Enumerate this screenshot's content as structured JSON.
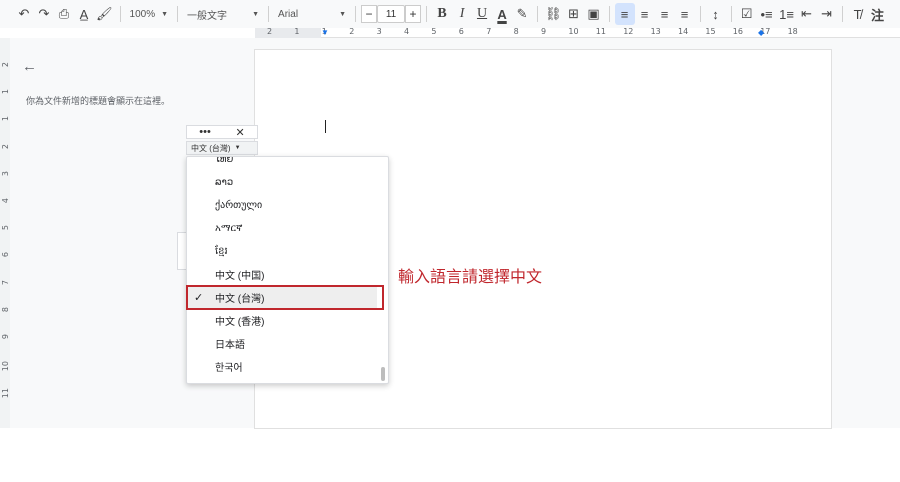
{
  "toolbar": {
    "zoom": "100%",
    "style": "一般文字",
    "font": "Arial",
    "font_size": "11",
    "minus": "−",
    "plus": "+",
    "bold": "B",
    "italic": "I",
    "underline": "U",
    "text_color": "A",
    "highlight": "✎",
    "link": "⛓",
    "comment": "⊞",
    "image": "▣",
    "align_left": "≡",
    "align_center": "≡",
    "align_right": "≡",
    "justify": "≡",
    "line_spacing": "↕",
    "checklist": "☑",
    "bullets": "•≡",
    "numbered": "1≡",
    "indent_less": "⇤",
    "indent_more": "⇥",
    "clear_format": "T̸",
    "input_tools": "注"
  },
  "ruler": {
    "numbers": [
      "2",
      "1",
      "1",
      "2",
      "3",
      "4",
      "5",
      "6",
      "7",
      "8",
      "9",
      "10",
      "11",
      "12",
      "13",
      "14",
      "15",
      "16",
      "17",
      "18"
    ]
  },
  "left_ruler": {
    "numbers": [
      "2",
      "1",
      "1",
      "2",
      "3",
      "4",
      "5",
      "6",
      "7",
      "8",
      "9",
      "10",
      "11"
    ]
  },
  "outline": {
    "hint": "你為文件新增的標題會顯示在這裡。"
  },
  "language_widget": {
    "more": "•••",
    "close": "✕",
    "selected": "中文 (台灣)"
  },
  "language_menu": {
    "items": [
      {
        "label": "ໄທຍ",
        "selected": false
      },
      {
        "label": "ລາວ",
        "selected": false
      },
      {
        "label": "ქართული",
        "selected": false
      },
      {
        "label": "አማርኛ",
        "selected": false
      },
      {
        "label": "ខ្មែរ",
        "selected": false
      },
      {
        "label": "中文 (中国)",
        "selected": false
      },
      {
        "label": "中文 (台灣)",
        "selected": true
      },
      {
        "label": "中文 (香港)",
        "selected": false
      },
      {
        "label": "日本語",
        "selected": false
      },
      {
        "label": "한국어",
        "selected": false
      }
    ]
  },
  "annotation": {
    "text": "輸入語言請選擇中文",
    "color": "#c0272d"
  }
}
